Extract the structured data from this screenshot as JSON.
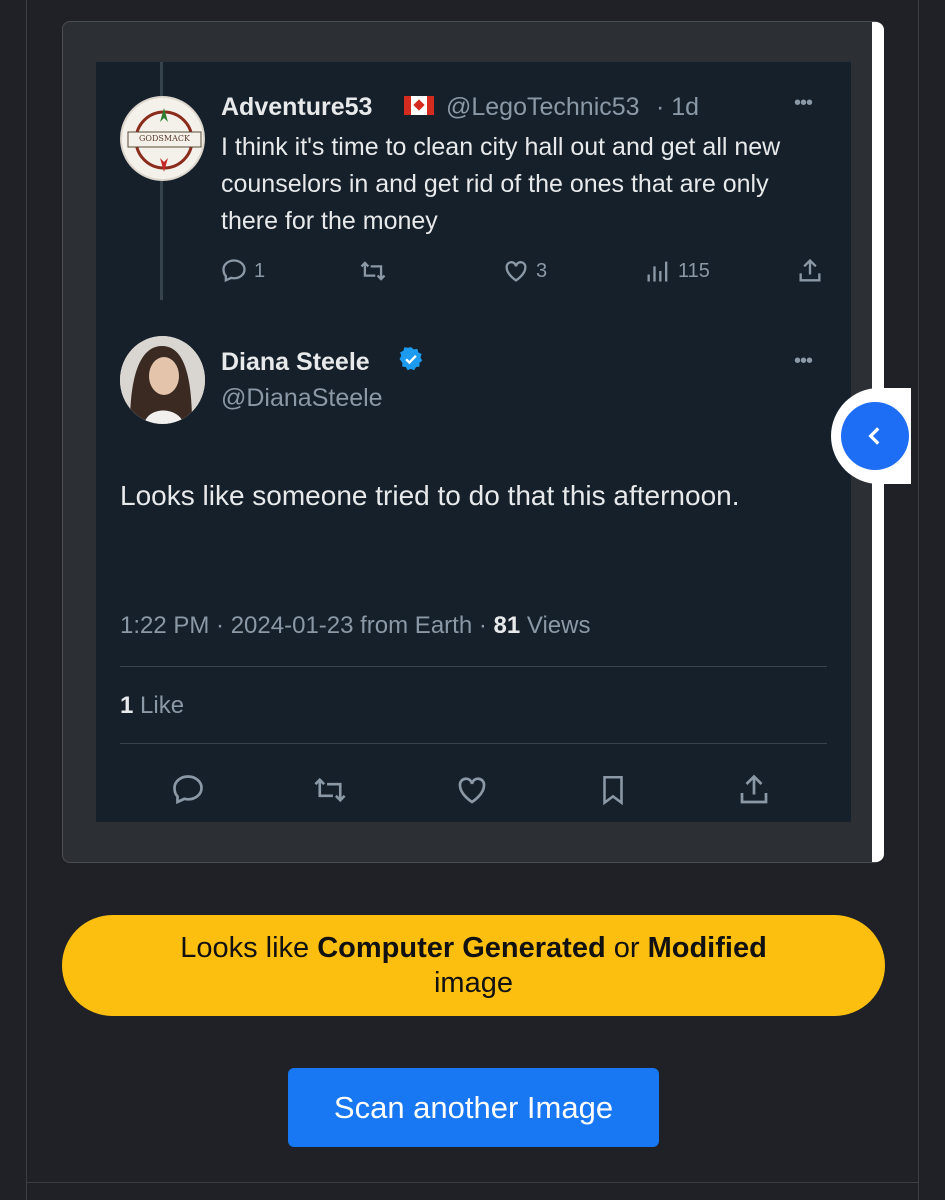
{
  "reply_tweet": {
    "name": "Adventure53",
    "handle": "@LegoTechnic53",
    "age": "· 1d",
    "text": "I think it's time to clean city hall out and get all new counselors in and get rid of the ones that are only there for the money",
    "replies": "1",
    "likes": "3",
    "views": "115",
    "avatar_text": "GODSMACK"
  },
  "main_tweet": {
    "name": "Diana Steele",
    "handle": "@DianaSteele",
    "text": "Looks like someone tried to do that this afternoon.",
    "time": "1:22 PM · 2024-01-23 from Earth ·",
    "views_count": "81",
    "views_label": "Views",
    "like_count": "1",
    "like_label": "Like"
  },
  "result": {
    "prefix": "Looks like",
    "strong1": "Computer Generated",
    "middle": "or",
    "strong2": "Modified",
    "suffix": "image"
  },
  "scan_button": "Scan another Image",
  "colors": {
    "background": "#1f2126",
    "tweet_bg": "#15202b",
    "verdict": "#fdbf0f",
    "button": "#1877f2",
    "verified": "#1d9bf0"
  },
  "icons": [
    "reply-icon",
    "retweet-icon",
    "like-icon",
    "views-icon",
    "share-icon",
    "bookmark-icon",
    "verified-icon",
    "chevron-left-icon",
    "more-icon"
  ]
}
